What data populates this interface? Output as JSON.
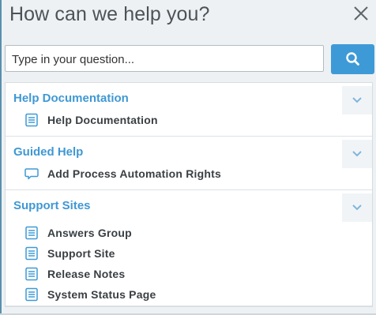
{
  "dialog": {
    "title": "How can we help you?",
    "close_icon": "close-icon"
  },
  "search": {
    "placeholder": "Type in your question...",
    "value": "",
    "button_icon": "search-icon"
  },
  "colors": {
    "accent": "#3e9ad6",
    "section_title": "#3f98d4",
    "text": "#3a3f43"
  },
  "sections": [
    {
      "title": "Help Documentation",
      "items": [
        {
          "label": "Help Documentation",
          "icon": "document-icon"
        }
      ]
    },
    {
      "title": "Guided Help",
      "items": [
        {
          "label": "Add Process Automation Rights",
          "icon": "chat-bubble-icon"
        }
      ]
    },
    {
      "title": "Support Sites",
      "items": [
        {
          "label": "Answers Group",
          "icon": "document-icon"
        },
        {
          "label": "Support Site",
          "icon": "document-icon"
        },
        {
          "label": "Release Notes",
          "icon": "document-icon"
        },
        {
          "label": "System Status Page",
          "icon": "document-icon"
        }
      ]
    }
  ]
}
